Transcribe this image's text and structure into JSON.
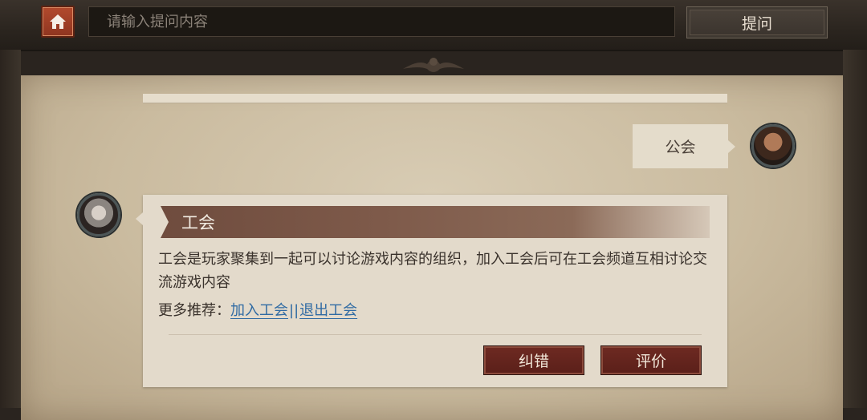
{
  "topbar": {
    "search": {
      "placeholder": "请输入提问内容",
      "value": ""
    },
    "ask_label": "提问"
  },
  "conversation": {
    "user_message": "公会",
    "answer": {
      "title": "工会",
      "body": "工会是玩家聚集到一起可以讨论游戏内容的组织，加入工会后可在工会频道互相讨论交流游戏内容",
      "more_label": "更多推荐：",
      "links": [
        "加入工会",
        "退出工会"
      ],
      "link_separator": "||"
    },
    "actions": {
      "correct_label": "纠错",
      "rate_label": "评价"
    }
  },
  "icons": {
    "home": "home-icon",
    "ornament": "ornament-icon"
  },
  "colors": {
    "accent": "#8f3520",
    "link": "#2f6aa3",
    "button": "#6e2a22"
  }
}
